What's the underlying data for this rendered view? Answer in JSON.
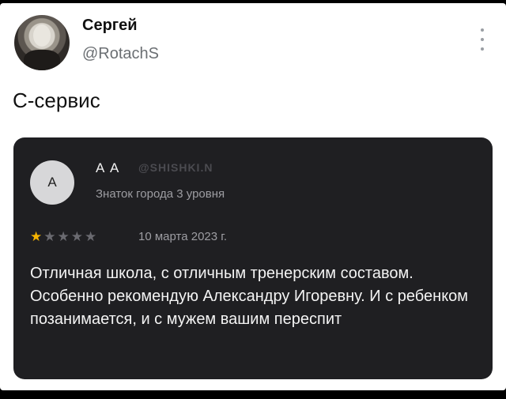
{
  "tweet": {
    "author_name": "Сергей",
    "author_handle": "@RotachS",
    "text": "С-сервис"
  },
  "review": {
    "avatar_letter": "А",
    "reviewer_name": "А А",
    "watermark": "@SHISHKI.N",
    "reviewer_level": "Знаток города 3 уровня",
    "rating": 1,
    "rating_max": 5,
    "date": "10 марта 2023 г.",
    "text": "Отличная школа, с отличным тренерским составом. Особенно рекомендую Александру Игоревну. И с ребенком позанимается, и с мужем вашим переспит"
  },
  "colors": {
    "card_background": "#1f1f22",
    "star_filled": "#f5b301",
    "star_empty": "#6a6a70"
  },
  "icons": {
    "more": "more-vertical-icon",
    "star": "star-icon"
  }
}
